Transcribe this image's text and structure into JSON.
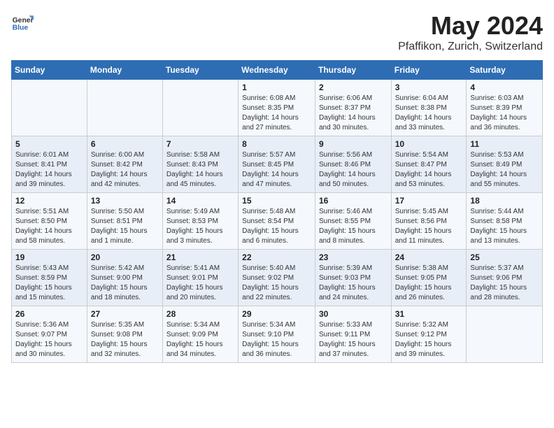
{
  "header": {
    "logo_general": "General",
    "logo_blue": "Blue",
    "main_title": "May 2024",
    "sub_title": "Pfaffikon, Zurich, Switzerland"
  },
  "weekdays": [
    "Sunday",
    "Monday",
    "Tuesday",
    "Wednesday",
    "Thursday",
    "Friday",
    "Saturday"
  ],
  "weeks": [
    [
      {
        "day": "",
        "info": ""
      },
      {
        "day": "",
        "info": ""
      },
      {
        "day": "",
        "info": ""
      },
      {
        "day": "1",
        "info": "Sunrise: 6:08 AM\nSunset: 8:35 PM\nDaylight: 14 hours\nand 27 minutes."
      },
      {
        "day": "2",
        "info": "Sunrise: 6:06 AM\nSunset: 8:37 PM\nDaylight: 14 hours\nand 30 minutes."
      },
      {
        "day": "3",
        "info": "Sunrise: 6:04 AM\nSunset: 8:38 PM\nDaylight: 14 hours\nand 33 minutes."
      },
      {
        "day": "4",
        "info": "Sunrise: 6:03 AM\nSunset: 8:39 PM\nDaylight: 14 hours\nand 36 minutes."
      }
    ],
    [
      {
        "day": "5",
        "info": "Sunrise: 6:01 AM\nSunset: 8:41 PM\nDaylight: 14 hours\nand 39 minutes."
      },
      {
        "day": "6",
        "info": "Sunrise: 6:00 AM\nSunset: 8:42 PM\nDaylight: 14 hours\nand 42 minutes."
      },
      {
        "day": "7",
        "info": "Sunrise: 5:58 AM\nSunset: 8:43 PM\nDaylight: 14 hours\nand 45 minutes."
      },
      {
        "day": "8",
        "info": "Sunrise: 5:57 AM\nSunset: 8:45 PM\nDaylight: 14 hours\nand 47 minutes."
      },
      {
        "day": "9",
        "info": "Sunrise: 5:56 AM\nSunset: 8:46 PM\nDaylight: 14 hours\nand 50 minutes."
      },
      {
        "day": "10",
        "info": "Sunrise: 5:54 AM\nSunset: 8:47 PM\nDaylight: 14 hours\nand 53 minutes."
      },
      {
        "day": "11",
        "info": "Sunrise: 5:53 AM\nSunset: 8:49 PM\nDaylight: 14 hours\nand 55 minutes."
      }
    ],
    [
      {
        "day": "12",
        "info": "Sunrise: 5:51 AM\nSunset: 8:50 PM\nDaylight: 14 hours\nand 58 minutes."
      },
      {
        "day": "13",
        "info": "Sunrise: 5:50 AM\nSunset: 8:51 PM\nDaylight: 15 hours\nand 1 minute."
      },
      {
        "day": "14",
        "info": "Sunrise: 5:49 AM\nSunset: 8:53 PM\nDaylight: 15 hours\nand 3 minutes."
      },
      {
        "day": "15",
        "info": "Sunrise: 5:48 AM\nSunset: 8:54 PM\nDaylight: 15 hours\nand 6 minutes."
      },
      {
        "day": "16",
        "info": "Sunrise: 5:46 AM\nSunset: 8:55 PM\nDaylight: 15 hours\nand 8 minutes."
      },
      {
        "day": "17",
        "info": "Sunrise: 5:45 AM\nSunset: 8:56 PM\nDaylight: 15 hours\nand 11 minutes."
      },
      {
        "day": "18",
        "info": "Sunrise: 5:44 AM\nSunset: 8:58 PM\nDaylight: 15 hours\nand 13 minutes."
      }
    ],
    [
      {
        "day": "19",
        "info": "Sunrise: 5:43 AM\nSunset: 8:59 PM\nDaylight: 15 hours\nand 15 minutes."
      },
      {
        "day": "20",
        "info": "Sunrise: 5:42 AM\nSunset: 9:00 PM\nDaylight: 15 hours\nand 18 minutes."
      },
      {
        "day": "21",
        "info": "Sunrise: 5:41 AM\nSunset: 9:01 PM\nDaylight: 15 hours\nand 20 minutes."
      },
      {
        "day": "22",
        "info": "Sunrise: 5:40 AM\nSunset: 9:02 PM\nDaylight: 15 hours\nand 22 minutes."
      },
      {
        "day": "23",
        "info": "Sunrise: 5:39 AM\nSunset: 9:03 PM\nDaylight: 15 hours\nand 24 minutes."
      },
      {
        "day": "24",
        "info": "Sunrise: 5:38 AM\nSunset: 9:05 PM\nDaylight: 15 hours\nand 26 minutes."
      },
      {
        "day": "25",
        "info": "Sunrise: 5:37 AM\nSunset: 9:06 PM\nDaylight: 15 hours\nand 28 minutes."
      }
    ],
    [
      {
        "day": "26",
        "info": "Sunrise: 5:36 AM\nSunset: 9:07 PM\nDaylight: 15 hours\nand 30 minutes."
      },
      {
        "day": "27",
        "info": "Sunrise: 5:35 AM\nSunset: 9:08 PM\nDaylight: 15 hours\nand 32 minutes."
      },
      {
        "day": "28",
        "info": "Sunrise: 5:34 AM\nSunset: 9:09 PM\nDaylight: 15 hours\nand 34 minutes."
      },
      {
        "day": "29",
        "info": "Sunrise: 5:34 AM\nSunset: 9:10 PM\nDaylight: 15 hours\nand 36 minutes."
      },
      {
        "day": "30",
        "info": "Sunrise: 5:33 AM\nSunset: 9:11 PM\nDaylight: 15 hours\nand 37 minutes."
      },
      {
        "day": "31",
        "info": "Sunrise: 5:32 AM\nSunset: 9:12 PM\nDaylight: 15 hours\nand 39 minutes."
      },
      {
        "day": "",
        "info": ""
      }
    ]
  ]
}
